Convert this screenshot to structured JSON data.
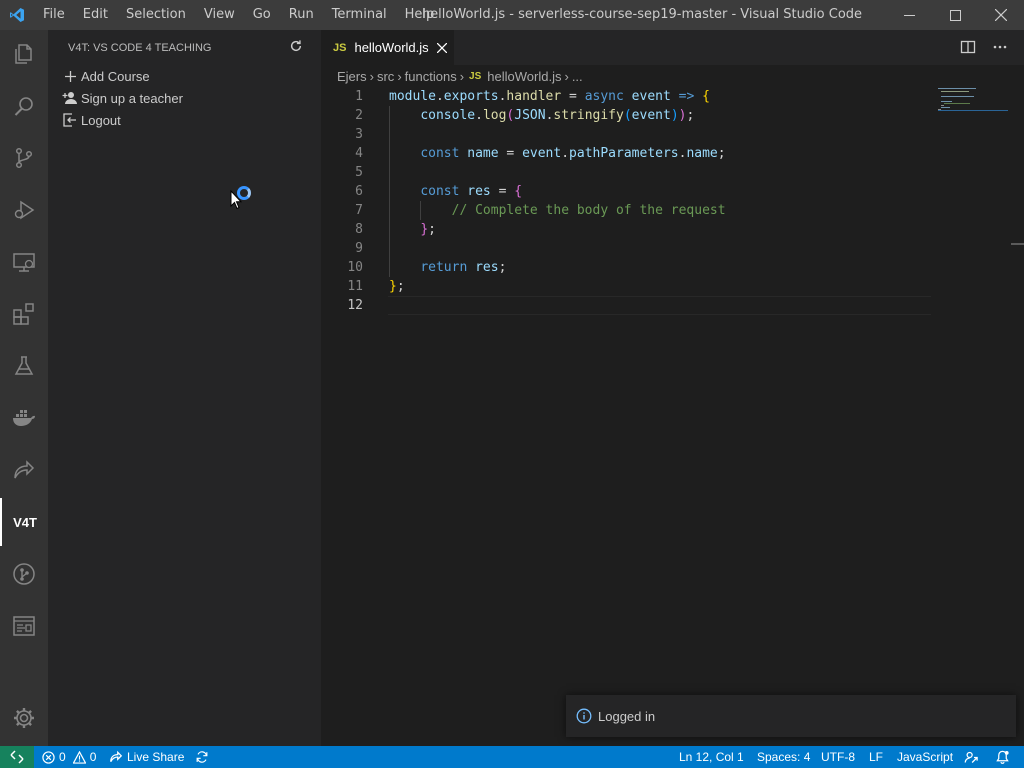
{
  "titlebar": {
    "menu": [
      "File",
      "Edit",
      "Selection",
      "View",
      "Go",
      "Run",
      "Terminal",
      "Help"
    ],
    "window_title": "helloWorld.js - serverless-course-sep19-master - Visual Studio Code"
  },
  "activitybar": {
    "items": [
      "files-icon",
      "search-icon",
      "source-control-icon",
      "run-debug-icon",
      "remote-explorer-icon",
      "extensions-icon",
      "testing-flask-icon",
      "docker-icon",
      "live-share-icon",
      "v4t",
      "git-graph-icon",
      "browser-preview-icon"
    ],
    "v4t_label": "V4T",
    "settings": "gear-icon"
  },
  "sidebar": {
    "title": "V4T: VS CODE 4 TEACHING",
    "items": [
      {
        "label": "Add Course",
        "icon": "plus-icon"
      },
      {
        "label": "Sign up a teacher",
        "icon": "person-add-icon"
      },
      {
        "label": "Logout",
        "icon": "sign-out-icon"
      }
    ]
  },
  "tabs": [
    {
      "badge": "JS",
      "title": "helloWorld.js",
      "active": true
    }
  ],
  "breadcrumb": {
    "parts": [
      "Ejers",
      "src",
      "functions"
    ],
    "file_badge": "JS",
    "file": "helloWorld.js",
    "tail": "..."
  },
  "editor": {
    "line_numbers": [
      "1",
      "2",
      "3",
      "4",
      "5",
      "6",
      "7",
      "8",
      "9",
      "10",
      "11",
      "12"
    ],
    "current_line": 12
  },
  "notification": {
    "message": "Logged in",
    "icon": "info-icon"
  },
  "statusbar": {
    "errors": "0",
    "warnings": "0",
    "live_share": "Live Share",
    "position": "Ln 12, Col 1",
    "spaces": "Spaces: 4",
    "encoding": "UTF-8",
    "eol": "LF",
    "language": "JavaScript"
  },
  "colors": {
    "accent": "#007acc",
    "remote": "#16825d",
    "js_badge": "#cbcb41"
  }
}
